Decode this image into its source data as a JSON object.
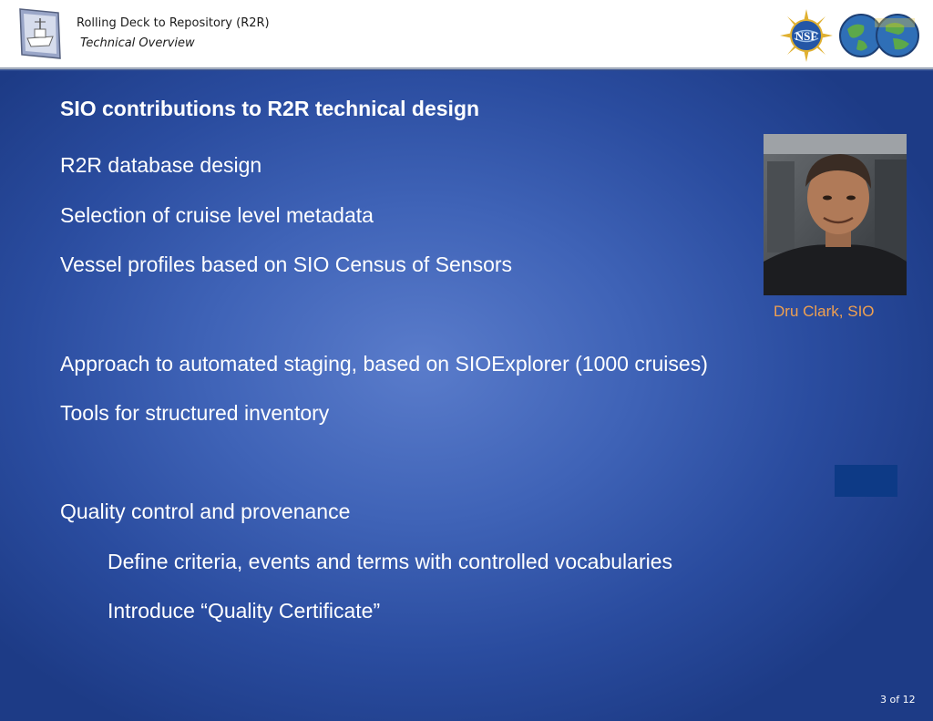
{
  "header": {
    "title": "Rolling Deck to Repository (R2R)",
    "subtitle": "Technical Overview",
    "logos": [
      "r2r-ship-icon",
      "nsf-logo",
      "unols-logo"
    ]
  },
  "slide": {
    "heading": "SIO contributions to R2R technical design",
    "bullets": [
      "R2R database design",
      "Selection of cruise level metadata",
      "Vessel profiles based on SIO Census of Sensors",
      "Approach to automated staging, based on SIOExplorer (1000 cruises)",
      "Tools for structured inventory",
      "Quality control and provenance"
    ],
    "sub_bullets": [
      "Define criteria, events and terms with controlled vocabularies",
      "Introduce “Quality Certificate”"
    ],
    "photo_caption": "Dru Clark, SIO",
    "page_number": "3 of 12"
  },
  "colors": {
    "background": "#3f63b7",
    "caption": "#f0a050",
    "text": "#ffffff",
    "box": "#0d3a86"
  }
}
